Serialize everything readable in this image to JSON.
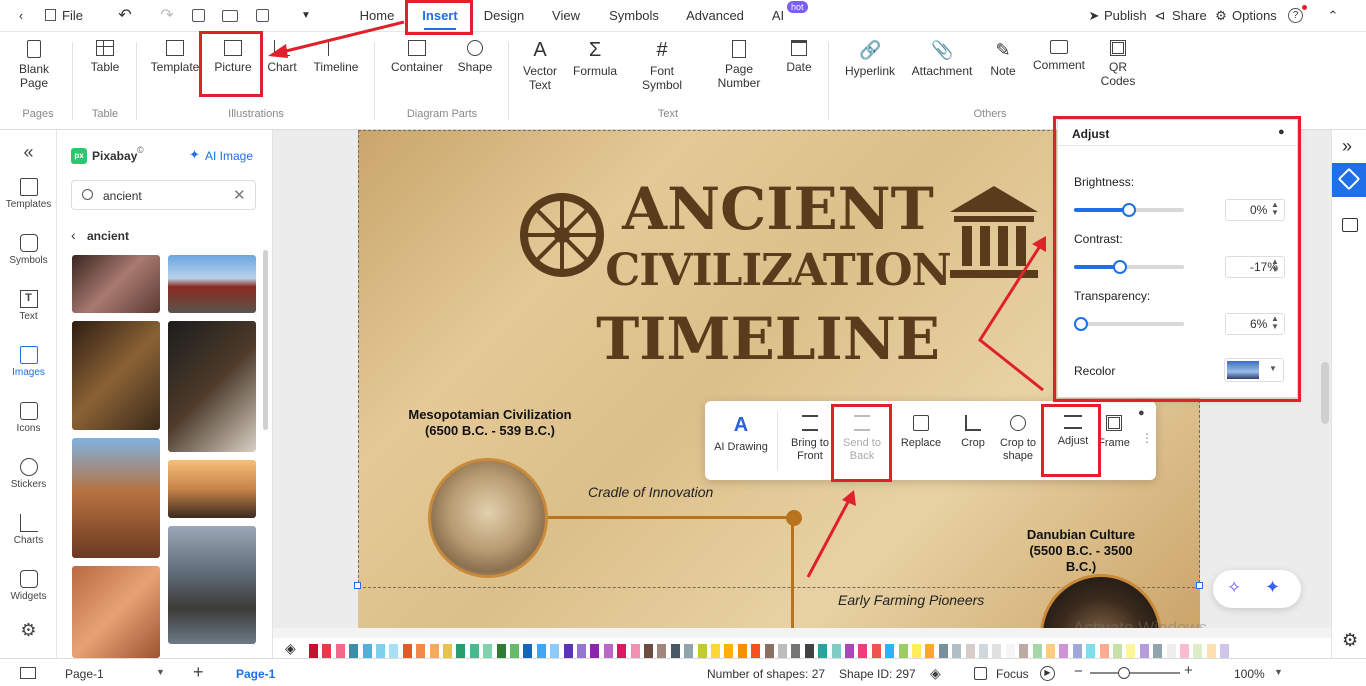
{
  "menubar": {
    "file": "File",
    "tabs": [
      "Home",
      "Insert",
      "Design",
      "View",
      "Symbols",
      "Advanced",
      "AI"
    ],
    "ai_badge": "hot",
    "publish": "Publish",
    "share": "Share",
    "options": "Options",
    "help": "?"
  },
  "ribbon": {
    "blank_page": [
      "Blank",
      "Page"
    ],
    "table": "Table",
    "template": "Template",
    "picture": "Picture",
    "chart": "Chart",
    "timeline": "Timeline",
    "container": "Container",
    "shape": "Shape",
    "vector_text": [
      "Vector",
      "Text"
    ],
    "formula": "Formula",
    "font_symbol": [
      "Font",
      "Symbol"
    ],
    "page_number": [
      "Page",
      "Number"
    ],
    "date": "Date",
    "hyperlink": "Hyperlink",
    "attachment": "Attachment",
    "note": "Note",
    "comment": "Comment",
    "qr_codes": [
      "QR",
      "Codes"
    ],
    "groups": [
      "Pages",
      "Table",
      "Illustrations",
      "Diagram Parts",
      "Text",
      "Others"
    ]
  },
  "leftbar": [
    "Templates",
    "Symbols",
    "Text",
    "Images",
    "Icons",
    "Stickers",
    "Charts",
    "Widgets"
  ],
  "panel": {
    "source": "Pixabay",
    "ai_image": "AI Image",
    "search_value": "ancient",
    "breadcrumb": "ancient"
  },
  "canvas": {
    "title": [
      "ANCIENT",
      "CIVILIZATION",
      "TIMELINE"
    ],
    "meso_title": [
      "Mesopotamian Civilization",
      "(6500 B.C. - 539 B.C.)"
    ],
    "cradle": "Cradle of Innovation",
    "farming": "Early Farming Pioneers",
    "danubian": [
      "Danubian Culture",
      "(5500 B.C. - 3500",
      "B.C.)"
    ]
  },
  "toolbar": {
    "ai_drawing": "AI Drawing",
    "bring_front": [
      "Bring to",
      "Front"
    ],
    "send_back": [
      "Send to",
      "Back"
    ],
    "replace": "Replace",
    "crop": "Crop",
    "crop_shape": [
      "Crop to",
      "shape"
    ],
    "adjust": "Adjust",
    "frame": "Frame"
  },
  "adjust": {
    "title": "Adjust",
    "brightness": {
      "label": "Brightness:",
      "value": "0%",
      "level": 0.5
    },
    "contrast": {
      "label": "Contrast:",
      "value": "-17%",
      "level": 0.42
    },
    "transparency": {
      "label": "Transparency:",
      "value": "6%",
      "level": 0.06
    },
    "recolor": "Recolor"
  },
  "status": {
    "page_select": "Page-1",
    "page_tab": "Page-1",
    "shapes": "Number of shapes: 27",
    "shape_id": "Shape ID: 297",
    "focus": "Focus",
    "zoom": "100%"
  },
  "watermark": "Activate Windows",
  "colors": {
    "accent": "#1e6fe8",
    "highlight": "#e0202a",
    "brown": "#5a3b1c"
  }
}
